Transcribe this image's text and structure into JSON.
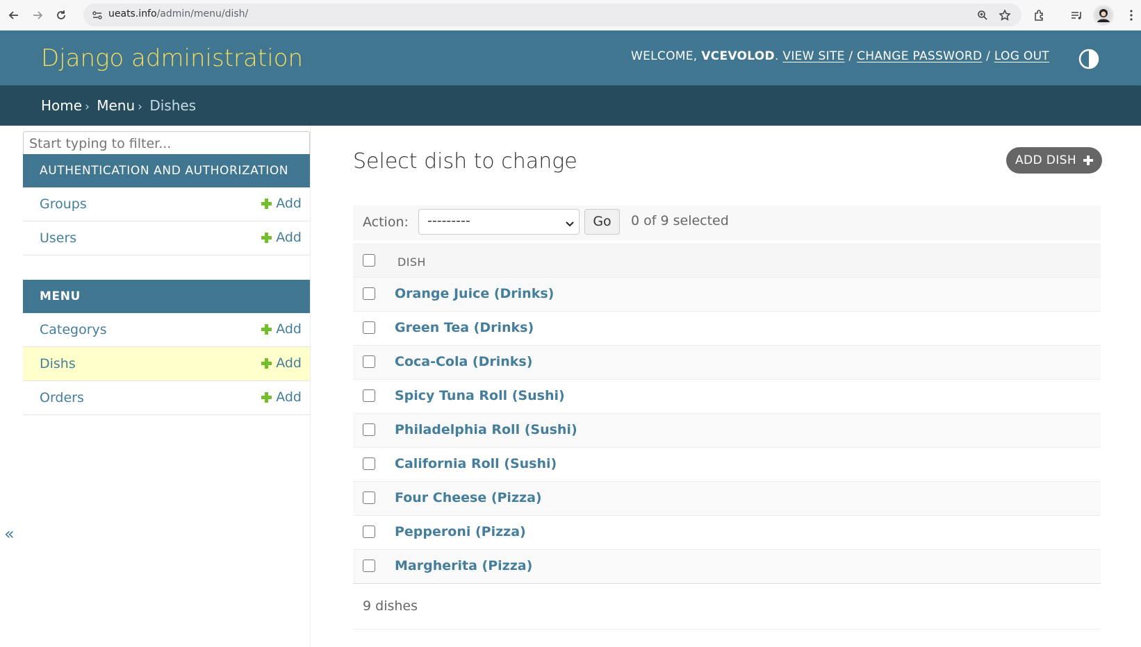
{
  "browser": {
    "url_domain": "ueats.info",
    "url_path": "/admin/menu/dish/"
  },
  "header": {
    "branding": "Django administration",
    "welcome": "WELCOME,",
    "username": "VCEVOLOD",
    "view_site": "VIEW SITE",
    "change_password": "CHANGE PASSWORD",
    "log_out": "LOG OUT",
    "sep": "/"
  },
  "breadcrumbs": {
    "home": "Home",
    "menu": "Menu",
    "current": "Dishes",
    "sep": "›"
  },
  "sidebar": {
    "filter_placeholder": "Start typing to filter...",
    "modules": [
      {
        "caption": "AUTHENTICATION AND AUTHORIZATION",
        "rows": [
          {
            "label": "Groups",
            "add": "Add"
          },
          {
            "label": "Users",
            "add": "Add"
          }
        ]
      },
      {
        "caption": "MENU",
        "rows": [
          {
            "label": "Categorys",
            "add": "Add"
          },
          {
            "label": "Dishs",
            "add": "Add"
          },
          {
            "label": "Orders",
            "add": "Add"
          }
        ]
      }
    ],
    "collapse_glyph": "«"
  },
  "content": {
    "title": "Select dish to change",
    "add_button": "ADD DISH",
    "action_label": "Action:",
    "action_selected": "---------",
    "go": "Go",
    "counter": "0 of 9 selected",
    "column_header": "DISH",
    "dishes": [
      "Orange Juice (Drinks)",
      "Green Tea (Drinks)",
      "Coca-Cola (Drinks)",
      "Spicy Tuna Roll (Sushi)",
      "Philadelphia Roll (Sushi)",
      "California Roll (Sushi)",
      "Four Cheese (Pizza)",
      "Pepperoni (Pizza)",
      "Margherita (Pizza)"
    ],
    "result_count": "9 dishes"
  },
  "colors": {
    "header_bg": "#417690",
    "breadcrumb_bg": "#264b5d",
    "branding": "#f5dd5d",
    "link": "#447e9b",
    "add_green": "#70bf2b",
    "selected_row": "#ffffcc"
  },
  "icons": [
    "back-icon",
    "forward-icon",
    "reload-icon",
    "site-info-icon",
    "zoom-icon",
    "star-icon",
    "extensions-icon",
    "reading-list-icon",
    "profile-icon",
    "theme-toggle-icon",
    "plus-icon",
    "chevron-down-icon"
  ]
}
